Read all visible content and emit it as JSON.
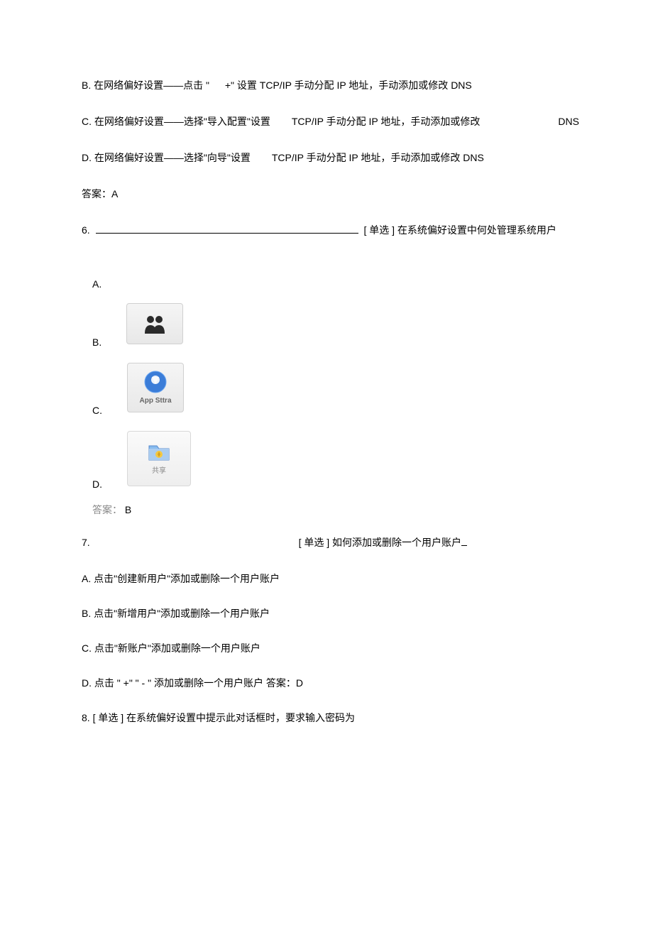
{
  "q5": {
    "optionB": {
      "prefix": "B.",
      "text1": "在网络偏好设置——点击 \"",
      "text2": "+\" 设置 TCP/IP 手动分配 IP 地址，手动添加或修改 DNS"
    },
    "optionC": {
      "prefix": "C.",
      "text1": "在网络偏好设置——选择\"导入配置\"设置",
      "text2": "TCP/IP 手动分配 IP 地址，手动添加或修改",
      "dns": "DNS"
    },
    "optionD": {
      "prefix": "D.",
      "text1": "在网络偏好设置——选择\"向导\"设置",
      "text2": "TCP/IP 手动分配 IP 地址，手动添加或修改 DNS"
    },
    "answer": "答案：A"
  },
  "q6": {
    "number": "6.",
    "text": "[ 单选 ] 在系统偏好设置中何处管理系统用户",
    "optionA_label": "A.",
    "optionB_label": "B.",
    "optionB_icon_text": "App Sttra",
    "optionC_label": "C.",
    "optionD_label": "D.",
    "optionD_icon_text": "共享",
    "answer_prefix": "答案：",
    "answer_letter": "B"
  },
  "q7": {
    "number": "7.",
    "text": "[ 单选 ] 如何添加或删除一个用户账户",
    "optionA": "A.  点击\"创建新用户\"添加或删除一个用户账户",
    "optionB": "B.  点击\"新增用户\"添加或删除一个用户账户",
    "optionC": "C.  点击\"新账户\"添加或删除一个用户账户",
    "optionD": "D.  点击 \" +\"   \" - \" 添加或删除一个用户账户 答案：D"
  },
  "q8": {
    "text": "8.      [ 单选 ] 在系统偏好设置中提示此对话框时，要求输入密码为"
  }
}
